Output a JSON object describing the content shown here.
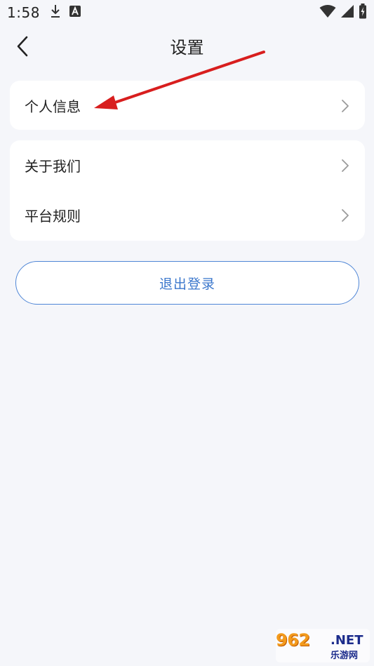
{
  "status_bar": {
    "time": "1:58",
    "left_icons": [
      "download-icon",
      "app-a-icon"
    ],
    "right_icons": [
      "wifi-icon",
      "signal-icon",
      "battery-icon"
    ]
  },
  "header": {
    "title": "设置",
    "back_icon": "chevron-left-icon"
  },
  "groups": [
    {
      "items": [
        {
          "label": "个人信息",
          "icon": "chevron-right-icon"
        }
      ]
    },
    {
      "items": [
        {
          "label": "关于我们",
          "icon": "chevron-right-icon"
        },
        {
          "label": "平台规则",
          "icon": "chevron-right-icon"
        }
      ]
    }
  ],
  "logout": {
    "label": "退出登录"
  },
  "annotation": {
    "color": "#d81e1e"
  },
  "watermark": {
    "main": "962",
    "net": ".NET",
    "sub": "乐游网"
  },
  "colors": {
    "background": "#f5f6fa",
    "card": "#ffffff",
    "accent": "#3b77cc"
  }
}
